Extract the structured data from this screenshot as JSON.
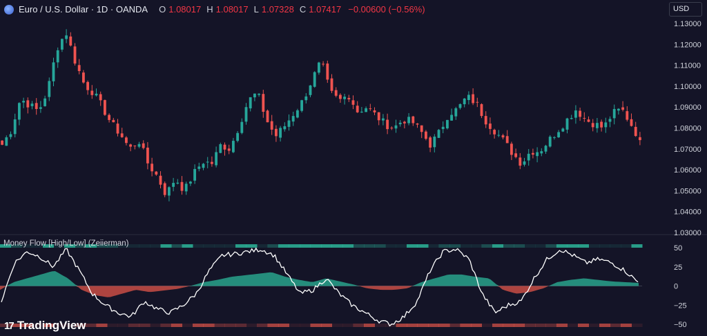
{
  "header": {
    "symbol_title": "Euro / U.S. Dollar · 1D · OANDA",
    "o_key": "O",
    "o_val": "1.08017",
    "h_key": "H",
    "h_val": "1.08017",
    "l_key": "L",
    "l_val": "1.07328",
    "c_key": "C",
    "c_val": "1.07417",
    "change": "−0.00600 (−0.56%)"
  },
  "currency_button": "USD",
  "indicator_label": "Money Flow [High/Low] (Zeiierman)",
  "logo_text": "TradingView",
  "colors": {
    "background": "#141427",
    "up": "#26a69a",
    "down": "#ef5350",
    "indicator_line": "#ffffff",
    "band_bull": "#2bb59a",
    "band_bear": "#e0544a"
  },
  "chart_data": [
    {
      "type": "candlestick",
      "symbol": "EURUSD",
      "timeframe": "1D",
      "ylim": [
        1.03,
        1.13
      ],
      "y_ticks": [
        "1.13000",
        "1.12000",
        "1.11000",
        "1.10000",
        "1.09000",
        "1.08000",
        "1.07000",
        "1.06000",
        "1.05000",
        "1.04000",
        "1.03000"
      ],
      "close_path": [
        1.072,
        1.079,
        1.094,
        1.091,
        1.088,
        1.098,
        1.118,
        1.126,
        1.112,
        1.101,
        1.097,
        1.09,
        1.082,
        1.077,
        1.07,
        1.074,
        1.063,
        1.057,
        1.048,
        1.056,
        1.05,
        1.058,
        1.064,
        1.063,
        1.072,
        1.07,
        1.081,
        1.093,
        1.097,
        1.084,
        1.076,
        1.081,
        1.087,
        1.093,
        1.103,
        1.112,
        1.097,
        1.093,
        1.096,
        1.088,
        1.09,
        1.086,
        1.082,
        1.08,
        1.084,
        1.083,
        1.078,
        1.072,
        1.078,
        1.087,
        1.089,
        1.095,
        1.092,
        1.084,
        1.079,
        1.074,
        1.068,
        1.063,
        1.069,
        1.069,
        1.074,
        1.079,
        1.084,
        1.089,
        1.084,
        1.082,
        1.08,
        1.087,
        1.089,
        1.082,
        1.0742
      ]
    },
    {
      "type": "line",
      "name": "Money Flow [High/Low] (Zeiierman)",
      "ylim": [
        -55,
        55
      ],
      "y_ticks": [
        50,
        25,
        0,
        -25,
        -50
      ],
      "line_path": [
        -20,
        30,
        45,
        38,
        25,
        48,
        20,
        -10,
        -25,
        -35,
        -40,
        -20,
        -30,
        -35,
        -25,
        -10,
        20,
        40,
        42,
        45,
        48,
        40,
        15,
        -10,
        -5,
        10,
        -10,
        -25,
        -35,
        -45,
        -50,
        -40,
        -20,
        20,
        45,
        48,
        35,
        -10,
        -35,
        -25,
        -20,
        10,
        35,
        48,
        40,
        30,
        35,
        30,
        20,
        5
      ],
      "fill_path": [
        -5,
        5,
        10,
        15,
        20,
        10,
        -5,
        -12,
        -15,
        -10,
        -5,
        -8,
        -6,
        -4,
        0,
        5,
        8,
        12,
        14,
        16,
        18,
        12,
        8,
        5,
        10,
        6,
        2,
        -3,
        -5,
        -5,
        -3,
        5,
        10,
        15,
        15,
        12,
        10,
        -5,
        -10,
        -8,
        -3,
        5,
        8,
        10,
        8,
        6,
        5,
        4
      ]
    }
  ]
}
